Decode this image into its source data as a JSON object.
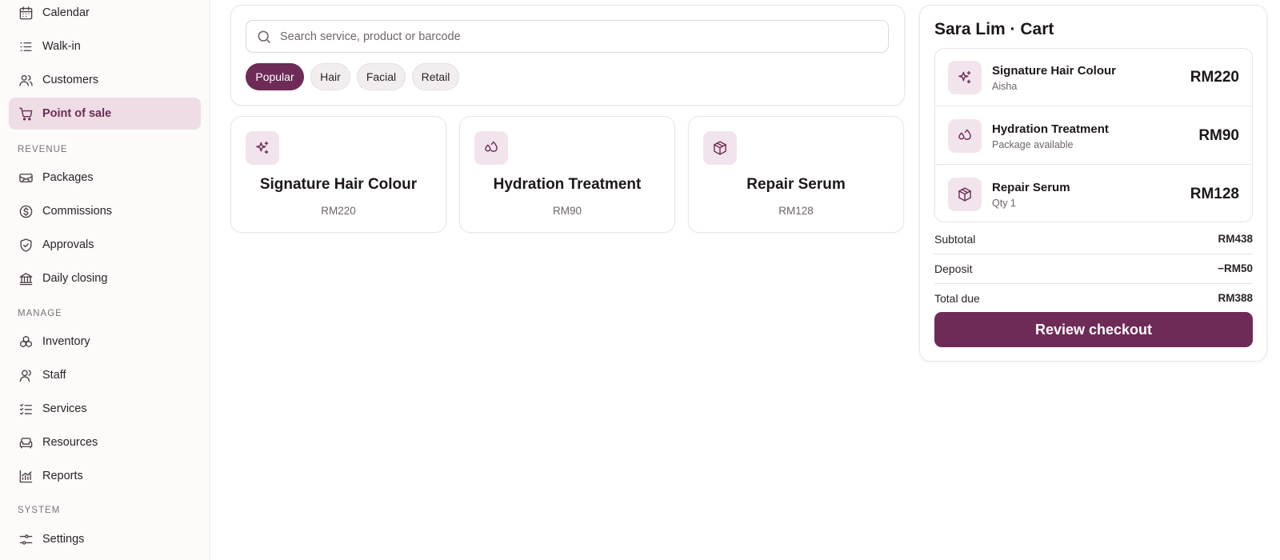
{
  "sidebar": {
    "items_top": [
      {
        "label": "Calendar",
        "icon": "calendar-icon"
      },
      {
        "label": "Walk-in",
        "icon": "list-icon"
      },
      {
        "label": "Customers",
        "icon": "users-icon"
      },
      {
        "label": "Point of sale",
        "icon": "cart-icon",
        "active": true
      }
    ],
    "section_revenue": "REVENUE",
    "items_revenue": [
      {
        "label": "Packages",
        "icon": "ticket-icon"
      },
      {
        "label": "Commissions",
        "icon": "dollar-circle-icon"
      },
      {
        "label": "Approvals",
        "icon": "shield-check-icon"
      },
      {
        "label": "Daily closing",
        "icon": "bank-icon"
      }
    ],
    "section_manage": "MANAGE",
    "items_manage": [
      {
        "label": "Inventory",
        "icon": "boxes-icon"
      },
      {
        "label": "Staff",
        "icon": "user-icon"
      },
      {
        "label": "Services",
        "icon": "list-checks-icon"
      },
      {
        "label": "Resources",
        "icon": "sofa-icon"
      },
      {
        "label": "Reports",
        "icon": "chart-icon"
      }
    ],
    "section_system": "SYSTEM",
    "items_system": [
      {
        "label": "Settings",
        "icon": "sliders-icon"
      }
    ]
  },
  "search": {
    "placeholder": "Search service, product or barcode",
    "value": ""
  },
  "chips": [
    {
      "label": "Popular",
      "active": true
    },
    {
      "label": "Hair",
      "active": false
    },
    {
      "label": "Facial",
      "active": false
    },
    {
      "label": "Retail",
      "active": false
    }
  ],
  "products": [
    {
      "name": "Signature Hair Colour",
      "price": "RM220",
      "icon": "sparkles-icon"
    },
    {
      "name": "Hydration Treatment",
      "price": "RM90",
      "icon": "droplets-icon"
    },
    {
      "name": "Repair Serum",
      "price": "RM128",
      "icon": "package-icon"
    }
  ],
  "cart": {
    "title": "Sara Lim · Cart",
    "lines": [
      {
        "name": "Signature Hair Colour",
        "sub": "Aisha",
        "price": "RM220",
        "icon": "sparkles-icon"
      },
      {
        "name": "Hydration Treatment",
        "sub": "Package available",
        "price": "RM90",
        "icon": "droplets-icon"
      },
      {
        "name": "Repair Serum",
        "sub": "Qty 1",
        "price": "RM128",
        "icon": "package-icon"
      }
    ],
    "subtotal_label": "Subtotal",
    "subtotal_value": "RM438",
    "deposit_label": "Deposit",
    "deposit_value": "−RM50",
    "total_label": "Total due",
    "total_value": "RM388",
    "checkout_label": "Review checkout"
  },
  "colors": {
    "accent": "#6e2b57",
    "active_nav_bg": "#efdde6",
    "icon_tile_bg": "#f2e4ec"
  }
}
